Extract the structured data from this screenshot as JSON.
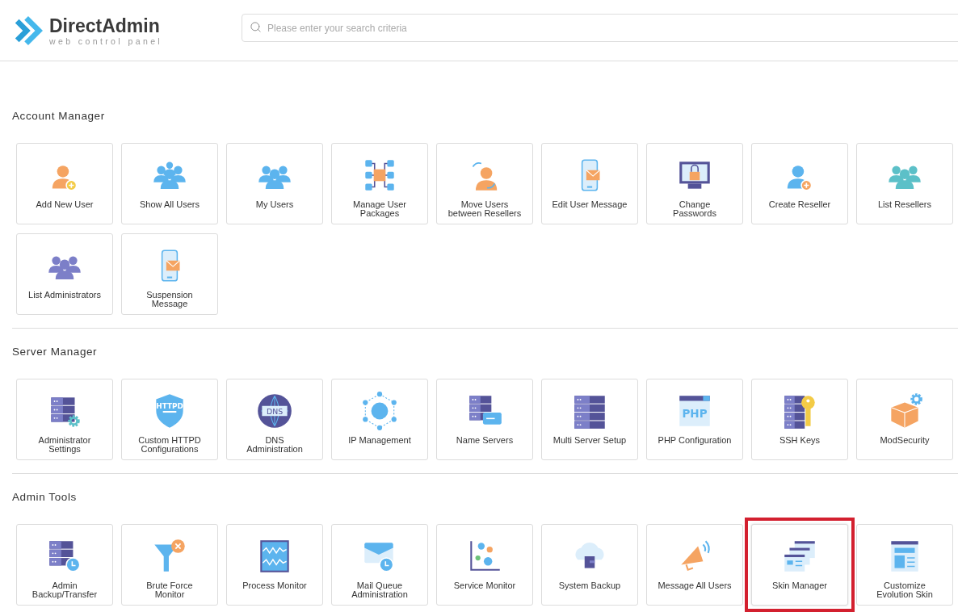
{
  "logo": {
    "name": "DirectAdmin",
    "tagline": "web control panel"
  },
  "search": {
    "placeholder": "Please enter your search criteria"
  },
  "sections": [
    {
      "title": "Account Manager",
      "items": [
        {
          "label": "Add New User",
          "highlighted": false
        },
        {
          "label": "Show All Users",
          "highlighted": false
        },
        {
          "label": "My Users",
          "highlighted": false
        },
        {
          "label": "Manage User Packages",
          "highlighted": false
        },
        {
          "label": "Move Users between Resellers",
          "highlighted": false
        },
        {
          "label": "Edit User Message",
          "highlighted": false
        },
        {
          "label": "Change Passwords",
          "highlighted": false
        },
        {
          "label": "Create Reseller",
          "highlighted": false
        },
        {
          "label": "List Resellers",
          "highlighted": false
        },
        {
          "label": "List Administrators",
          "highlighted": false
        },
        {
          "label": "Suspension Message",
          "highlighted": false
        }
      ]
    },
    {
      "title": "Server Manager",
      "items": [
        {
          "label": "Administrator Settings",
          "highlighted": false
        },
        {
          "label": "Custom HTTPD Configurations",
          "highlighted": false,
          "icon_text": "HTTPD"
        },
        {
          "label": "DNS Administration",
          "highlighted": false,
          "icon_text": "DNS"
        },
        {
          "label": "IP Management",
          "highlighted": false
        },
        {
          "label": "Name Servers",
          "highlighted": false
        },
        {
          "label": "Multi Server Setup",
          "highlighted": false
        },
        {
          "label": "PHP Configuration",
          "highlighted": false,
          "icon_text": "PHP"
        },
        {
          "label": "SSH Keys",
          "highlighted": false
        },
        {
          "label": "ModSecurity",
          "highlighted": false
        }
      ]
    },
    {
      "title": "Admin Tools",
      "items": [
        {
          "label": "Admin Backup/Transfer",
          "highlighted": false
        },
        {
          "label": "Brute Force Monitor",
          "highlighted": false
        },
        {
          "label": "Process Monitor",
          "highlighted": false
        },
        {
          "label": "Mail Queue Administration",
          "highlighted": false
        },
        {
          "label": "Service Monitor",
          "highlighted": false
        },
        {
          "label": "System Backup",
          "highlighted": false
        },
        {
          "label": "Message All Users",
          "highlighted": false
        },
        {
          "label": "Skin Manager",
          "highlighted": true
        },
        {
          "label": "Customize Evolution Skin",
          "highlighted": false
        }
      ]
    }
  ]
}
